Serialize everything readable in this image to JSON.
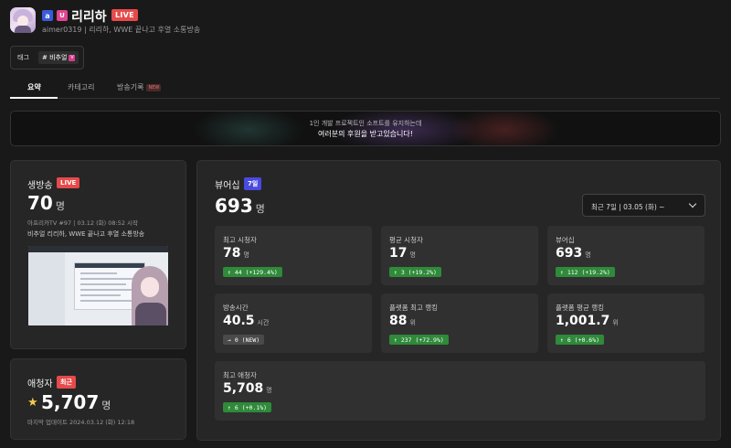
{
  "header": {
    "badge_a": "a",
    "badge_u": "U",
    "name": "리리하",
    "live": "LIVE",
    "subline": "aimer0319 | 리리하, WWE 끝나고 후열 소통방송"
  },
  "tags": {
    "label": "태그",
    "chip": "# 비추얼",
    "chip_icon": "V"
  },
  "tabs": [
    {
      "label": "요약"
    },
    {
      "label": "카테고리"
    },
    {
      "label": "방송기록",
      "badge": "NEW"
    }
  ],
  "banner": {
    "line1": "1인 개발 프로젝트인 소프트를 유지하는데",
    "line2": "여러분의 후원을 받고있습니다!"
  },
  "live_card": {
    "title": "생방송",
    "badge": "LIVE",
    "count": "70",
    "unit": "명",
    "meta": "아프리카TV #97 | 03.12 (화) 08:52 시작",
    "stream_title": "비추얼 리리하, WWE 끝나고 후열 소통방송"
  },
  "fan_card": {
    "title": "애청자",
    "badge": "최근",
    "count": "5,707",
    "unit": "명",
    "updated": "마지막 업데이트 2024.03.12 (화) 12:18"
  },
  "viewer_card": {
    "title": "뷰어십",
    "badge": "7일",
    "count": "693",
    "unit": "명",
    "period_select": "최근 7일 | 03.05 (화) ~",
    "tiles": [
      {
        "label": "최고 시청자",
        "value": "78",
        "unit": "명",
        "change": "↑ 44 (+129.4%)",
        "trend": "up"
      },
      {
        "label": "평균 시청자",
        "value": "17",
        "unit": "명",
        "change": "↑ 3 (+19.2%)",
        "trend": "up"
      },
      {
        "label": "뷰어십",
        "value": "693",
        "unit": "명",
        "change": "↑ 112 (+19.2%)",
        "trend": "up"
      },
      {
        "label": "방송시간",
        "value": "40.5",
        "unit": "시간",
        "change": "→ 0 (NEW)",
        "trend": "neutral"
      },
      {
        "label": "플랫폼 최고 랭킹",
        "value": "88",
        "unit": "위",
        "change": "↑ 237 (+72.9%)",
        "trend": "up"
      },
      {
        "label": "플랫폼 평균 랭킹",
        "value": "1,001.7",
        "unit": "위",
        "change": "↑ 6 (+0.6%)",
        "trend": "up"
      },
      {
        "label": "최고 애청자",
        "value": "5,708",
        "unit": "명",
        "change": "↑ 6 (+0.1%)",
        "trend": "up"
      }
    ]
  },
  "colors": {
    "live_red": "#e64a4a",
    "period_blue": "#4a4ae0",
    "up_green": "#2f8a3a",
    "star": "#f2c94c"
  }
}
